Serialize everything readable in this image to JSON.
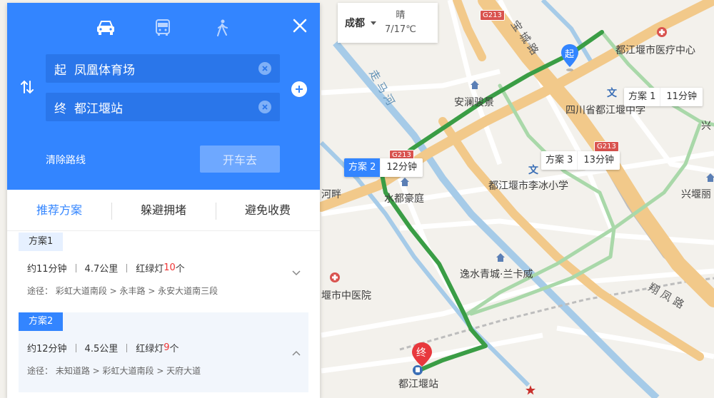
{
  "map": {
    "labels": {
      "hospital1": "都江堰市医疗中心",
      "school1": "四川省都江堰中学",
      "poi_anlan": "安澜骏景",
      "poi_shuidu": "水都豪庭",
      "school2": "都江堰市李冰小学",
      "poi_yishui": "逸水青城·兰卡威",
      "hospital2": "堰市中医院",
      "edge_hepan": "河畔",
      "edge_xing": "兴",
      "edge_xingli": "兴堰丽",
      "station": "都江堰站",
      "road_xiangfeng": "翔 凤 路",
      "road_zoumahe": "走 马 河",
      "road_top": "宝 城 路"
    },
    "highway_badges": [
      "G213",
      "G213",
      "G213"
    ],
    "pin_start": "起",
    "pin_end": "终",
    "route_tags": [
      {
        "name": "方案 1",
        "time": "11分钟"
      },
      {
        "name": "方案 2",
        "time": "12分钟"
      },
      {
        "name": "方案 3",
        "time": "13分钟"
      }
    ],
    "colors": {
      "active_route": "#3a9d45",
      "inactive_route": "#a9d8a9",
      "road_main": "#f2c98a",
      "water": "#a6cbe8"
    }
  },
  "weather": {
    "city": "成都",
    "condition": "晴",
    "temp": "7/17℃"
  },
  "panel": {
    "modes": [
      {
        "icon": "car-icon"
      },
      {
        "icon": "bus-icon"
      },
      {
        "icon": "walk-icon"
      }
    ],
    "start": {
      "prefix": "起",
      "value": "凤凰体育场"
    },
    "end": {
      "prefix": "终",
      "value": "都江堰站"
    },
    "clear_route": "清除路线",
    "go_button": "开车去",
    "accent": "#3385ff",
    "tabs": [
      "推荐方案",
      "躲避拥堵",
      "避免收费"
    ],
    "plans": [
      {
        "label": "方案1",
        "time": "约11分钟",
        "distance": "4.7公里",
        "lights_prefix": "红绿灯",
        "lights_count": "10",
        "lights_suffix": "个",
        "via": "途径： 彩虹大道南段 > 永丰路 > 永安大道南三段"
      },
      {
        "label": "方案2",
        "time": "约12分钟",
        "distance": "4.5公里",
        "lights_prefix": "红绿灯",
        "lights_count": "9",
        "lights_suffix": "个",
        "via": "途径： 未知道路 > 彩虹大道南段 > 天府大道"
      }
    ]
  }
}
